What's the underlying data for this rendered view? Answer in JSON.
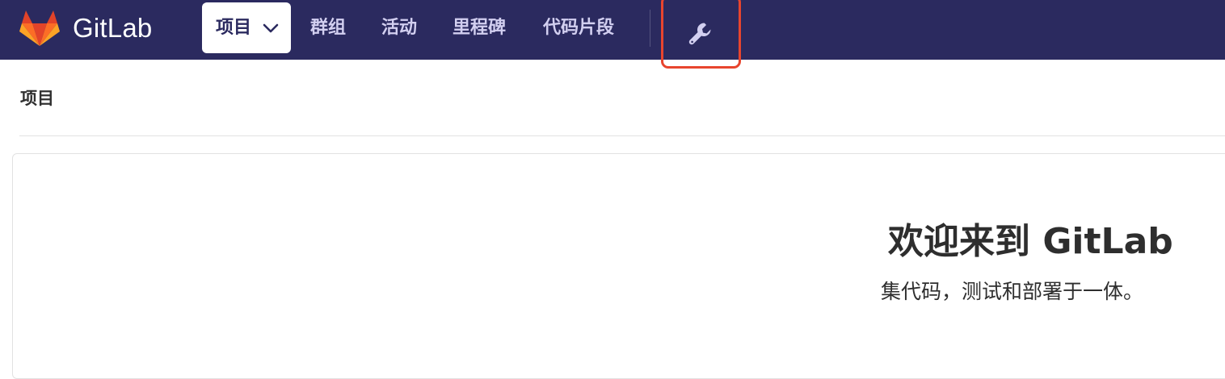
{
  "navbar": {
    "brand": "GitLab",
    "projects_label": "项目",
    "links": [
      "群组",
      "活动",
      "里程碑",
      "代码片段"
    ],
    "admin_icon": "wrench-icon",
    "logo_icon": "gitlab-fox-logo",
    "background_color": "#2b2a5f",
    "highlight_color": "#e8452e"
  },
  "breadcrumb": {
    "title": "项目"
  },
  "welcome": {
    "title": "欢迎来到 GitLab",
    "subtitle": "集代码，测试和部署于一体。"
  }
}
